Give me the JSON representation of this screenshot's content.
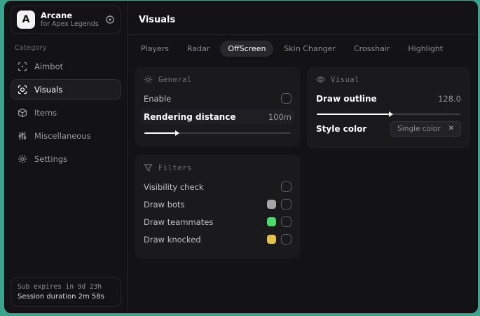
{
  "brand": {
    "initial": "A",
    "name": "Arcane",
    "subtitle": "for Apex Legends"
  },
  "sidebar": {
    "category_label": "Category",
    "items": [
      {
        "label": "Aimbot"
      },
      {
        "label": "Visuals"
      },
      {
        "label": "Items"
      },
      {
        "label": "Miscellaneous"
      },
      {
        "label": "Settings"
      }
    ],
    "footer": {
      "expires": "Sub expires in 9d 23h",
      "session": "Session duration 2m 58s"
    }
  },
  "main": {
    "title": "Visuals",
    "tabs": [
      {
        "label": "Players"
      },
      {
        "label": "Radar"
      },
      {
        "label": "OffScreen"
      },
      {
        "label": "Skin Changer"
      },
      {
        "label": "Crosshair"
      },
      {
        "label": "Highlight"
      }
    ],
    "general": {
      "title": "General",
      "enable_label": "Enable",
      "distance_label": "Rendering distance",
      "distance_value": "100m",
      "distance_percent": 21
    },
    "visual": {
      "title": "Visual",
      "outline_label": "Draw outline",
      "outline_value": "128.0",
      "outline_percent": 50,
      "style_label": "Style color",
      "style_selected": "Single color",
      "style_clear": "✕"
    },
    "filters": {
      "title": "Filters",
      "rows": [
        {
          "label": "Visibility check",
          "swatch": ""
        },
        {
          "label": "Draw bots",
          "swatch": "#a6a6a8"
        },
        {
          "label": "Draw teammates",
          "swatch": "#4cd96e"
        },
        {
          "label": "Draw knocked",
          "swatch": "#e3c24c"
        }
      ]
    }
  },
  "colors": {
    "desktop_background": "#3aa58c",
    "window_background": "#131315",
    "panel_background": "#1a1a1d"
  }
}
